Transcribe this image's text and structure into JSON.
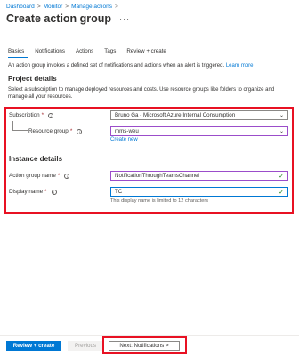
{
  "breadcrumb": [
    "Dashboard",
    "Monitor",
    "Manage actions"
  ],
  "page": {
    "title": "Create action group",
    "more": "···"
  },
  "tabs": [
    "Basics",
    "Notifications",
    "Actions",
    "Tags",
    "Review + create"
  ],
  "intro": {
    "text": "An action group invokes a defined set of notifications and actions when an alert is triggered.",
    "link": "Learn more"
  },
  "project": {
    "heading": "Project details",
    "description": "Select a subscription to manage deployed resources and costs. Use resource groups like folders to organize and manage all your resources."
  },
  "form": {
    "subscription_label": "Subscription",
    "subscription_value": "Bruno Ga - Microsoft Azure Internal Consumption",
    "resource_group_label": "Resource group",
    "resource_group_value": "mms-weu",
    "create_new": "Create new",
    "instance_heading": "Instance details",
    "action_group_name_label": "Action group name",
    "action_group_name_value": "NotificationThroughTeamsChannel",
    "display_name_label": "Display name",
    "display_name_value": "TC",
    "display_name_hint": "This display name is limited to 12 characters",
    "required_mark": "*",
    "info_icon": "i"
  },
  "footer": {
    "review_create": "Review + create",
    "previous": "Previous",
    "next": "Next: Notifications >"
  },
  "colors": {
    "accent": "#0078d4",
    "highlight": "#e81123",
    "valid": "#107c10"
  }
}
